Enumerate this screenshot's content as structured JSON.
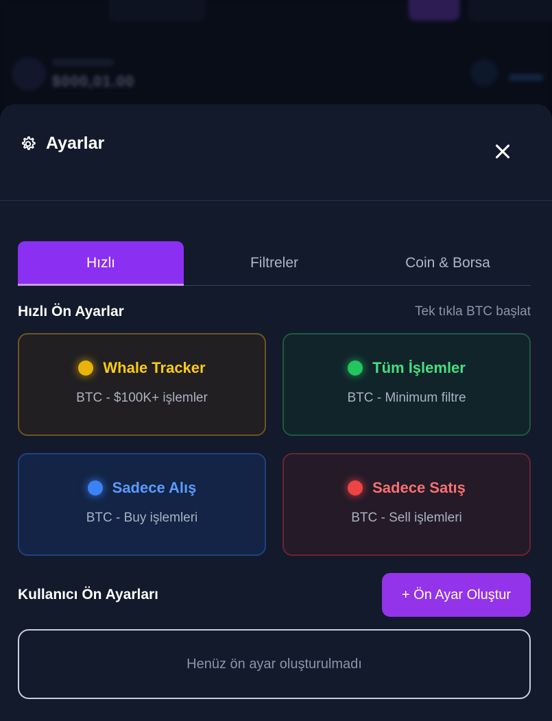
{
  "background": {
    "value": "$000,01.00"
  },
  "header": {
    "title": "Ayarlar",
    "icon": "gear-icon",
    "close_icon": "close-icon"
  },
  "tabs": [
    {
      "label": "Hızlı",
      "active": true
    },
    {
      "label": "Filtreler",
      "active": false
    },
    {
      "label": "Coin & Borsa",
      "active": false
    }
  ],
  "quick_presets": {
    "title": "Hızlı Ön Ayarlar",
    "hint": "Tek tıkla BTC başlat",
    "cards": [
      {
        "name": "Whale Tracker",
        "subtitle": "BTC - $100K+ işlemler",
        "color": "#facc15"
      },
      {
        "name": "Tüm İşlemler",
        "subtitle": "BTC - Minimum filtre",
        "color": "#4ade80"
      },
      {
        "name": "Sadece Alış",
        "subtitle": "BTC - Buy işlemleri",
        "color": "#5b9bff"
      },
      {
        "name": "Sadece Satış",
        "subtitle": "BTC - Sell işlemleri",
        "color": "#f87171"
      }
    ]
  },
  "user_presets": {
    "title": "Kullanıcı Ön Ayarları",
    "create_label": "+ Ön Ayar Oluştur",
    "empty_text": "Henüz ön ayar oluşturulmadı"
  },
  "colors": {
    "accent": "#9333ea",
    "sheet_bg": "#121a2b"
  }
}
